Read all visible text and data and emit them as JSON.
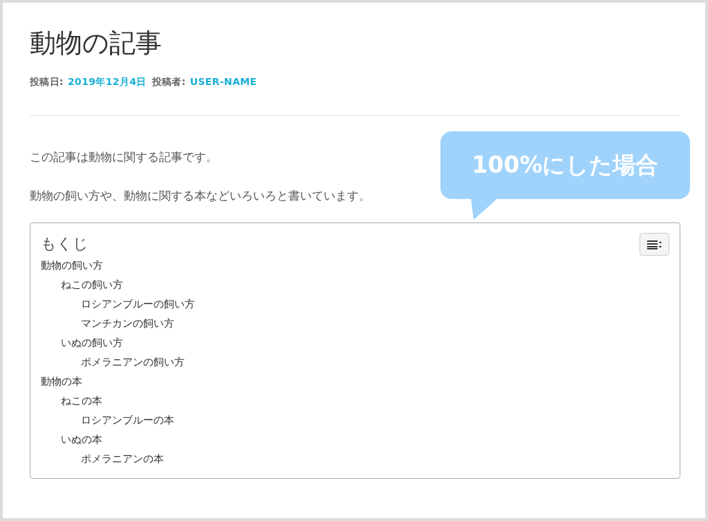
{
  "article": {
    "title": "動物の記事",
    "meta": [
      {
        "label": "投稿日:",
        "value": "2019年12月4日"
      },
      {
        "label": "投稿者:",
        "value": "USER-NAME"
      }
    ],
    "paragraphs": [
      "この記事は動物に関する記事です。",
      "動物の飼い方や、動物に関する本などいろいろと書いています。"
    ]
  },
  "callout": {
    "text": "100%にした場合"
  },
  "toc": {
    "title": "もくじ",
    "items": [
      {
        "label": "動物の飼い方",
        "children": [
          {
            "label": "ねこの飼い方",
            "children": [
              {
                "label": "ロシアンブルーの飼い方"
              },
              {
                "label": "マンチカンの飼い方"
              }
            ]
          },
          {
            "label": "いぬの飼い方",
            "children": [
              {
                "label": "ポメラニアンの飼い方"
              }
            ]
          }
        ]
      },
      {
        "label": "動物の本",
        "children": [
          {
            "label": "ねこの本",
            "children": [
              {
                "label": "ロシアンブルーの本"
              }
            ]
          },
          {
            "label": "いぬの本",
            "children": [
              {
                "label": "ポメラニアンの本"
              }
            ]
          }
        ]
      }
    ]
  }
}
